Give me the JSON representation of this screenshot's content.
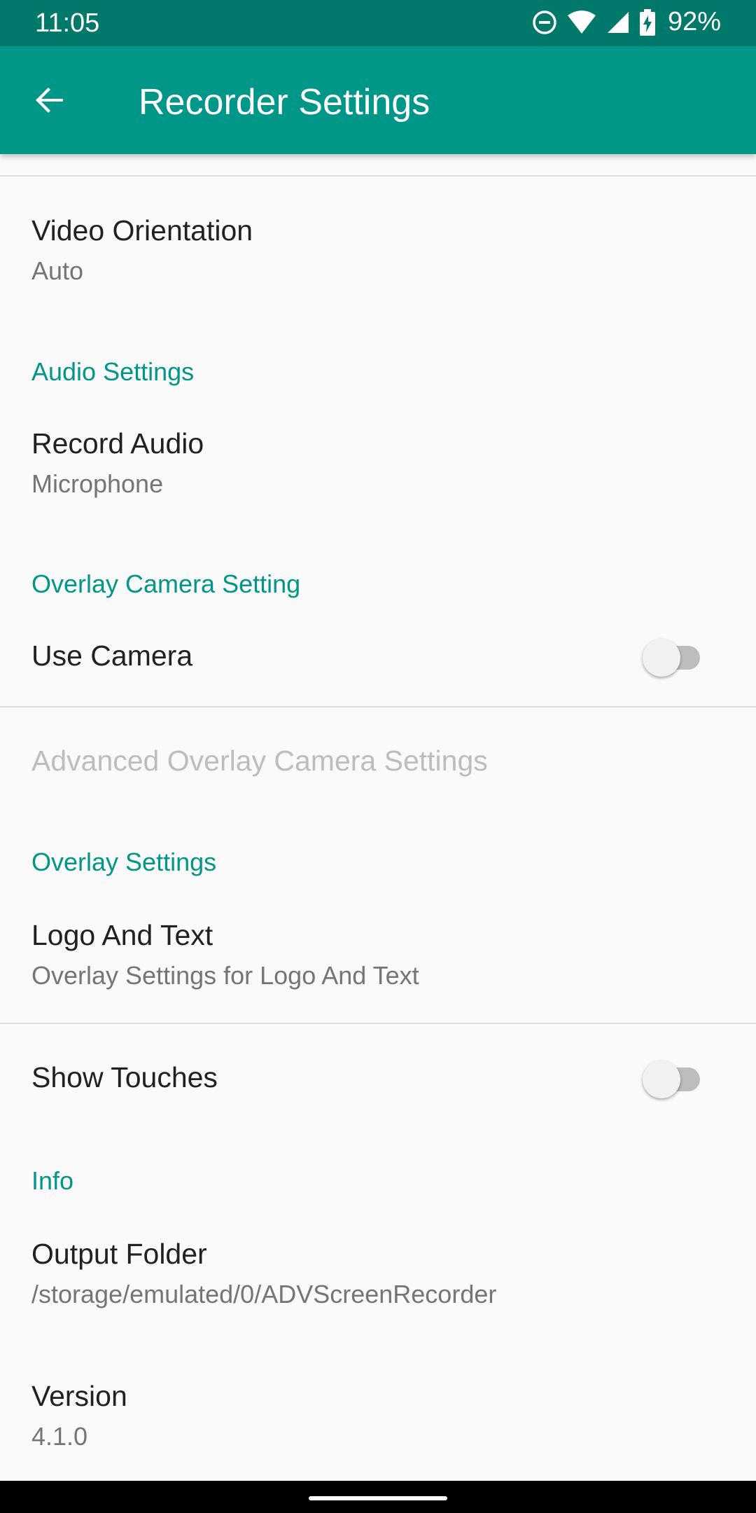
{
  "status_bar": {
    "time": "11:05",
    "battery": "92%",
    "icons": [
      "dnd-icon",
      "wifi-icon",
      "signal-icon",
      "battery-charging-icon"
    ]
  },
  "app_bar": {
    "title": "Recorder Settings",
    "back_icon": "arrow-back-icon"
  },
  "colors": {
    "status_bar": "#00796b",
    "app_bar": "#009688",
    "accent": "#009688",
    "background": "#fafafa"
  },
  "preferences": {
    "video_orientation": {
      "title": "Video Orientation",
      "summary": "Auto"
    },
    "audio_category": "Audio Settings",
    "record_audio": {
      "title": "Record Audio",
      "summary": "Microphone"
    },
    "overlay_camera_category": "Overlay Camera Setting",
    "use_camera": {
      "title": "Use Camera",
      "enabled": false
    },
    "advanced_camera": {
      "title": "Advanced Overlay Camera Settings",
      "disabled": true
    },
    "overlay_category": "Overlay Settings",
    "logo_text": {
      "title": "Logo And Text",
      "summary": "Overlay Settings for Logo And Text"
    },
    "show_touches": {
      "title": "Show Touches",
      "enabled": false
    },
    "info_category": "Info",
    "output_folder": {
      "title": "Output Folder",
      "summary": "/storage/emulated/0/ADVScreenRecorder"
    },
    "version": {
      "title": "Version",
      "summary": "4.1.0"
    }
  }
}
